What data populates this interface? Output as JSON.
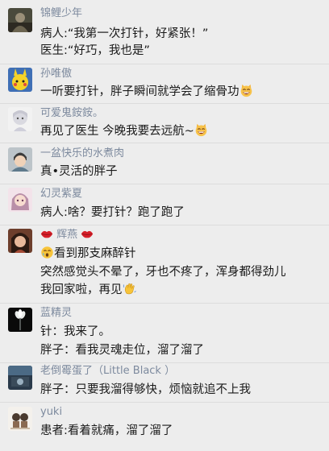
{
  "comments": [
    {
      "name": "锦鲤少年",
      "lines": [
        "病人:“我第一次打针，好紧张！”",
        "医生:“好巧，我也是”"
      ]
    },
    {
      "name": "孙唯傲",
      "lines": [
        "一听要打针，胖子瞬间就学会了缩骨功"
      ]
    },
    {
      "name": "可爱鬼銨銨。",
      "lines": [
        "再见了医生 今晚我要去远航~"
      ]
    },
    {
      "name": "一盆快乐的水煮肉",
      "lines": [
        "真•灵活的胖子"
      ]
    },
    {
      "name": "幻灵紫夏",
      "lines": [
        "病人:啥？要打针？跑了跑了"
      ]
    },
    {
      "name": "辉燕",
      "lines": [
        "看到那支麻醉针",
        "突然感觉头不晕了，牙也不疼了，浑身都得劲儿",
        "我回家啦，再见"
      ]
    },
    {
      "name": "蓝精灵",
      "lines": [
        "针：我来了。",
        "胖子：看我灵魂走位，溜了溜了"
      ]
    },
    {
      "name": "老倒霉蛋了（Little Black ）",
      "lines": [
        "胖子：只要我溜得够快，烦恼就追不上我"
      ]
    },
    {
      "name": "yuki",
      "lines": [
        "患者:看着就痛，溜了溜了"
      ]
    }
  ],
  "icons": {
    "grin_cat": "grinning-cat-emoji",
    "crying_face": "crying-face-emoji",
    "waving_hand": "waving-hand-emoji",
    "lips": "lips-emoji"
  },
  "colors": {
    "background": "#ededed",
    "name_text": "#7d8a9e",
    "body_text": "#1a1a1a",
    "separator": "#dcdcdc"
  }
}
